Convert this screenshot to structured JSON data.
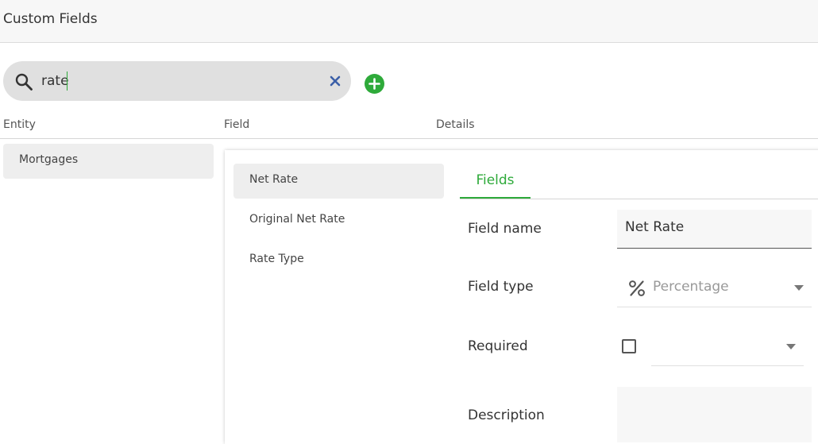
{
  "header": {
    "title": "Custom Fields"
  },
  "search": {
    "value": "rate",
    "clear_icon": "close-icon",
    "add_icon": "plus-circle-icon"
  },
  "columns": {
    "entity": "Entity",
    "field": "Field",
    "details": "Details"
  },
  "entities": [
    {
      "label": "Mortgages",
      "selected": true
    }
  ],
  "fields": [
    {
      "label": "Net Rate",
      "selected": true
    },
    {
      "label": "Original Net Rate",
      "selected": false
    },
    {
      "label": "Rate Type",
      "selected": false
    }
  ],
  "details": {
    "tabs": [
      {
        "label": "Fields",
        "active": true
      }
    ],
    "form": {
      "field_name_label": "Field name",
      "field_name_value": "Net Rate",
      "field_type_label": "Field type",
      "field_type_value": "Percentage",
      "field_type_icon": "percent-icon",
      "required_label": "Required",
      "required_checked": false,
      "description_label": "Description",
      "description_value": ""
    }
  },
  "colors": {
    "accent": "#2eaa3a",
    "clear": "#3b5fa8",
    "selected_bg": "#eeeeee"
  }
}
